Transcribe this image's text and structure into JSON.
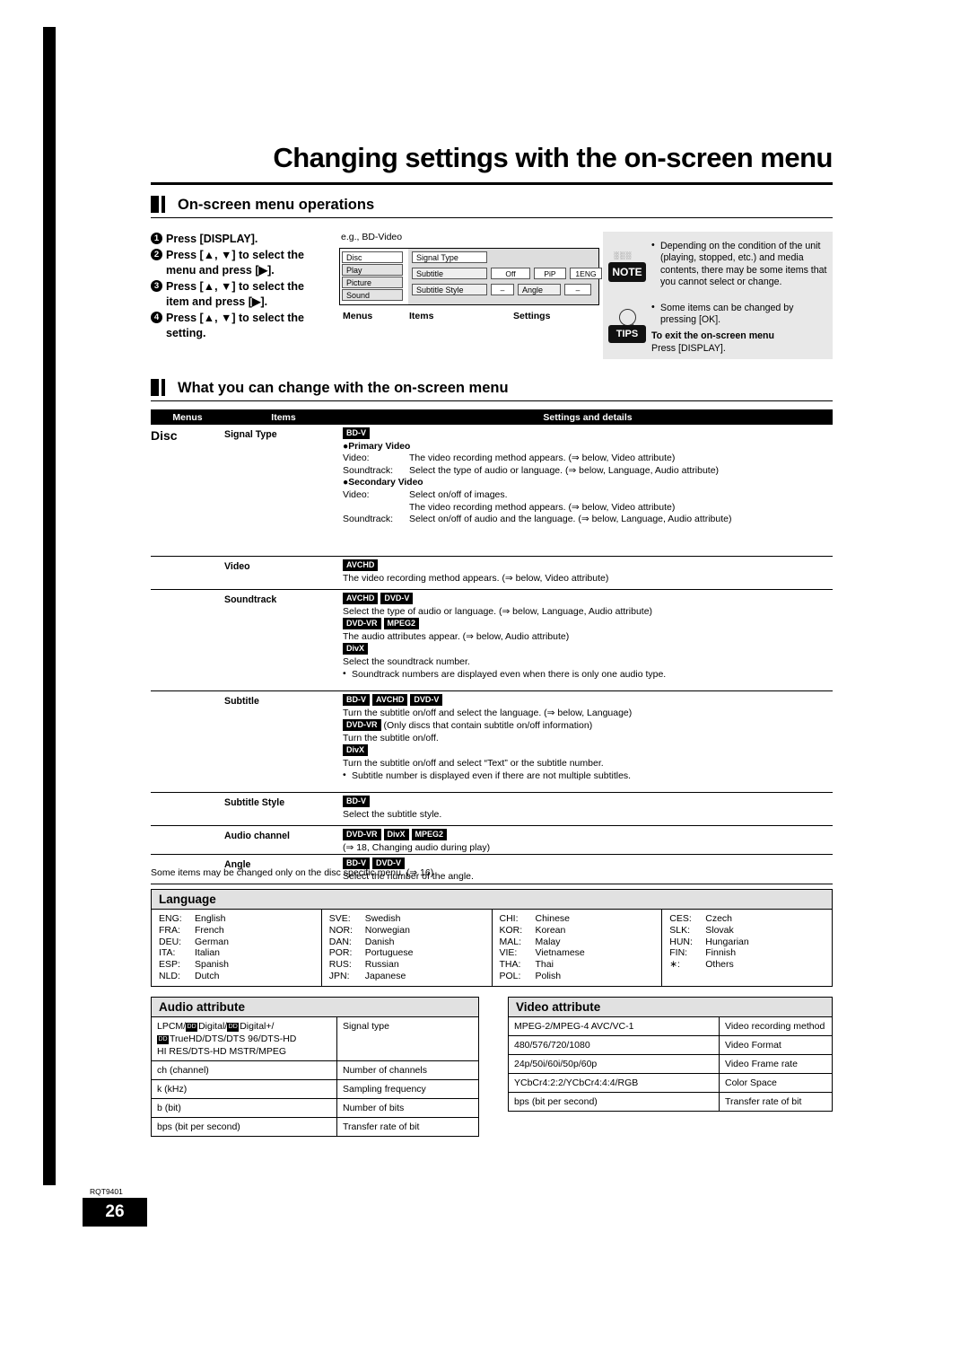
{
  "page_title": "Changing settings with the on-screen menu",
  "section1": {
    "heading": "On-screen menu operations",
    "steps": [
      "Press [DISPLAY].",
      "Press [▲, ▼] to select the menu and press [▶].",
      "Press [▲, ▼] to select the item and press [▶].",
      "Press [▲, ▼] to select the setting."
    ],
    "eg_label": "e.g., BD-Video",
    "osd": {
      "menus": [
        "Disc",
        "Play",
        "Picture",
        "Sound"
      ],
      "items": [
        "Signal Type",
        "Subtitle",
        "Subtitle Style"
      ],
      "values": [
        "Off",
        "PiP",
        "1ENG",
        "–",
        "Angle",
        "–"
      ],
      "labels": {
        "menus": "Menus",
        "items": "Items",
        "settings": "Settings"
      }
    },
    "note": {
      "badge": "NOTE",
      "badge_sub": "░░░",
      "lines": [
        "Depending on the condition of the unit (playing, stopped, etc.) and media contents, there may be some items that you cannot select or change.",
        "Some items can be changed by pressing [OK]."
      ]
    },
    "tips": {
      "badge": "TIPS",
      "title": "To exit the on-screen menu",
      "text": "Press [DISPLAY]."
    }
  },
  "section2": {
    "heading": "What you can change with the on-screen menu",
    "table_headers": [
      "Menus",
      "Items",
      "Settings and details"
    ],
    "menu_name": "Disc",
    "rows": [
      {
        "item": "Signal Type",
        "tags": [
          "BD-V"
        ],
        "blocks": [
          {
            "type": "subhead",
            "text": "Primary Video"
          },
          {
            "type": "pair",
            "label": "Video:",
            "text": "The video recording method appears. (⇒ below, Video attribute)"
          },
          {
            "type": "pair",
            "label": "Soundtrack:",
            "text": "Select the type of audio or language. (⇒ below, Language, Audio attribute)"
          },
          {
            "type": "subhead",
            "text": "Secondary Video"
          },
          {
            "type": "pair",
            "label": "Video:",
            "text": "Select on/off of images."
          },
          {
            "type": "pair",
            "label": "",
            "text": "The video recording method appears. (⇒ below, Video attribute)"
          },
          {
            "type": "pair",
            "label": "Soundtrack:",
            "text": "Select on/off of audio and the language. (⇒ below, Language, Audio attribute)"
          }
        ]
      },
      {
        "item": "Video",
        "tags": [
          "AVCHD"
        ],
        "blocks": [
          {
            "type": "text",
            "text": "The video recording method appears. (⇒ below, Video attribute)"
          }
        ]
      },
      {
        "item": "Soundtrack",
        "tags": [
          "AVCHD",
          "DVD-V"
        ],
        "blocks": [
          {
            "type": "text",
            "text": "Select the type of audio or language. (⇒ below, Language, Audio attribute)"
          },
          {
            "type": "tags",
            "tags": [
              "DVD-VR",
              "MPEG2"
            ]
          },
          {
            "type": "text",
            "text": "The audio attributes appear. (⇒ below, Audio attribute)"
          },
          {
            "type": "tags",
            "tags": [
              "DivX"
            ]
          },
          {
            "type": "text",
            "text": "Select the soundtrack number."
          },
          {
            "type": "bullet",
            "text": "Soundtrack numbers are displayed even when there is only one audio type."
          }
        ]
      },
      {
        "item": "Subtitle",
        "tags": [
          "BD-V",
          "AVCHD",
          "DVD-V"
        ],
        "blocks": [
          {
            "type": "text",
            "text": "Turn the subtitle on/off and select the language. (⇒ below, Language)"
          },
          {
            "type": "tagtext",
            "tags": [
              "DVD-VR"
            ],
            "text": "(Only discs that contain subtitle on/off information)"
          },
          {
            "type": "text",
            "text": "Turn the subtitle on/off."
          },
          {
            "type": "tags",
            "tags": [
              "DivX"
            ]
          },
          {
            "type": "text",
            "text": "Turn the subtitle on/off and select “Text” or the subtitle number."
          },
          {
            "type": "bullet",
            "text": "Subtitle number is displayed even if there are not multiple subtitles."
          }
        ]
      },
      {
        "item": "Subtitle Style",
        "tags": [
          "BD-V"
        ],
        "blocks": [
          {
            "type": "text",
            "text": "Select the subtitle style."
          }
        ]
      },
      {
        "item": "Audio channel",
        "tags": [
          "DVD-VR",
          "DivX",
          "MPEG2"
        ],
        "blocks": [
          {
            "type": "text",
            "text": "(⇒ 18, Changing audio during play)"
          }
        ]
      },
      {
        "item": "Angle",
        "tags": [
          "BD-V",
          "DVD-V"
        ],
        "blocks": [
          {
            "type": "text",
            "text": "Select the number of the angle."
          }
        ]
      }
    ],
    "footnote": "Some items may be changed only on the disc specific menu. (⇒ 16)"
  },
  "language": {
    "heading": "Language",
    "columns": [
      [
        [
          "ENG:",
          "English"
        ],
        [
          "FRA:",
          "French"
        ],
        [
          "DEU:",
          "German"
        ],
        [
          "ITA:",
          "Italian"
        ],
        [
          "ESP:",
          "Spanish"
        ],
        [
          "NLD:",
          "Dutch"
        ]
      ],
      [
        [
          "SVE:",
          "Swedish"
        ],
        [
          "NOR:",
          "Norwegian"
        ],
        [
          "DAN:",
          "Danish"
        ],
        [
          "POR:",
          "Portuguese"
        ],
        [
          "RUS:",
          "Russian"
        ],
        [
          "JPN:",
          "Japanese"
        ]
      ],
      [
        [
          "CHI:",
          "Chinese"
        ],
        [
          "KOR:",
          "Korean"
        ],
        [
          "MAL:",
          "Malay"
        ],
        [
          "VIE:",
          "Vietnamese"
        ],
        [
          "THA:",
          "Thai"
        ],
        [
          "POL:",
          "Polish"
        ]
      ],
      [
        [
          "CES:",
          "Czech"
        ],
        [
          "SLK:",
          "Slovak"
        ],
        [
          "HUN:",
          "Hungarian"
        ],
        [
          "FIN:",
          "Finnish"
        ],
        [
          "∗:",
          "Others"
        ],
        [
          "",
          ""
        ]
      ]
    ]
  },
  "audio_attribute": {
    "heading": "Audio attribute",
    "rows": [
      {
        "left": "LPCM/■Digital/■Digital+/\n■TrueHD/DTS/DTS 96/DTS-HD\nHI RES/DTS-HD MSTR/MPEG",
        "right": "Signal type"
      },
      {
        "left": "ch (channel)",
        "right": "Number of channels"
      },
      {
        "left": "k (kHz)",
        "right": "Sampling frequency"
      },
      {
        "left": "b (bit)",
        "right": "Number of bits"
      },
      {
        "left": "bps (bit per second)",
        "right": "Transfer rate of bit"
      }
    ]
  },
  "video_attribute": {
    "heading": "Video attribute",
    "rows": [
      {
        "left": "MPEG-2/MPEG-4 AVC/VC-1",
        "right": "Video recording method"
      },
      {
        "left": "480/576/720/1080",
        "right": "Video Format"
      },
      {
        "left": "24p/50i/60i/50p/60p",
        "right": "Video Frame rate"
      },
      {
        "left": "YCbCr4:2:2/YCbCr4:4:4/RGB",
        "right": "Color Space"
      },
      {
        "left": "bps (bit per second)",
        "right": "Transfer rate of bit"
      }
    ]
  },
  "footer": {
    "doc_code": "RQT9401",
    "page_number": "26"
  }
}
